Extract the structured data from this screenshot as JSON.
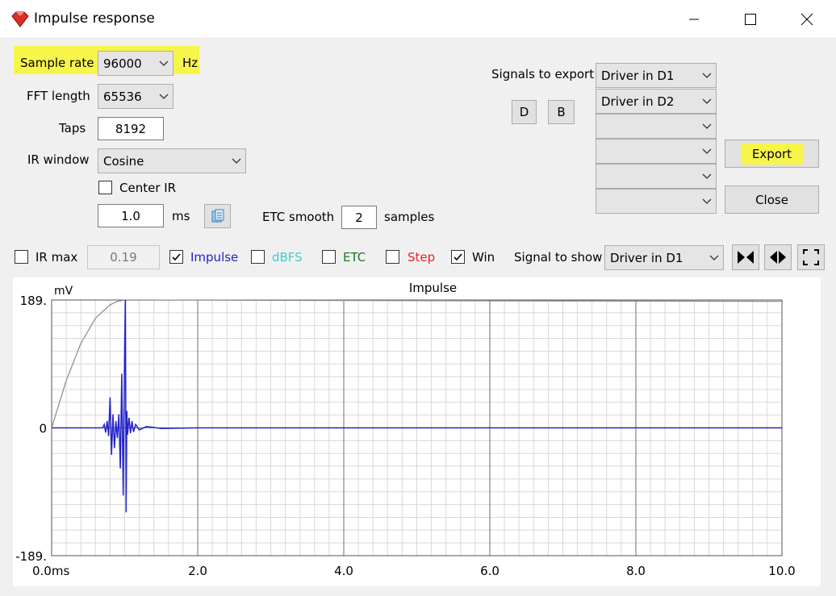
{
  "window": {
    "title": "Impulse response",
    "icon": "red-diamond-app-icon",
    "buttons": [
      "minimize-icon",
      "maximize-icon",
      "close-icon"
    ]
  },
  "settings": {
    "sample_rate_label": "Sample rate",
    "sample_rate_value": "96000",
    "sample_rate_unit": "Hz",
    "fft_label": "FFT length",
    "fft_value": "65536",
    "taps_label": "Taps",
    "taps_value": "8192",
    "ir_window_label": "IR window",
    "ir_window_value": "Cosine",
    "center_ir_label": "Center IR",
    "center_ir_checked": false,
    "ms_value": "1.0",
    "ms_unit": "ms",
    "etc_smooth_label": "ETC smooth",
    "etc_smooth_value": "2",
    "etc_smooth_unit": "samples"
  },
  "export": {
    "signals_label": "Signals to export",
    "d_button": "D",
    "b_button": "B",
    "signals": [
      "Driver in D1",
      "Driver in D2",
      "",
      "",
      "",
      ""
    ],
    "export_button": "Export",
    "close_button": "Close"
  },
  "toolbar": {
    "ir_max_label": "IR max",
    "ir_max_checked": false,
    "ir_max_value": "0.19",
    "impulse_label": "Impulse",
    "impulse_checked": true,
    "dbfs_label": "dBFS",
    "dbfs_checked": false,
    "etc_label": "ETC",
    "etc_checked": false,
    "step_label": "Step",
    "step_checked": false,
    "win_label": "Win",
    "win_checked": true,
    "signal_to_show_label": "Signal to show",
    "signal_to_show_value": "Driver in D1",
    "icons": [
      "collapse-icon",
      "expand-icon",
      "fullscreen-icon"
    ]
  },
  "colors": {
    "highlight": "#f8f54a",
    "impulse": "#2222cc",
    "dbfs": "#44cccc",
    "etc": "#227722",
    "step": "#ee2222",
    "window": "#888888"
  },
  "chart_data": {
    "type": "line",
    "title": "Impulse",
    "xlabel": "",
    "ylabel": "mV",
    "xlim": [
      0,
      10
    ],
    "ylim": [
      -189,
      189
    ],
    "x_ticks": [
      "0.0ms",
      "2.0",
      "4.0",
      "6.0",
      "8.0",
      "10.0"
    ],
    "y_ticks": [
      "189.",
      "0",
      "-189."
    ],
    "grid": true,
    "series": [
      {
        "color": "#2222cc",
        "x": [
          0,
          0.4,
          0.7,
          0.72,
          0.74,
          0.76,
          0.78,
          0.8,
          0.82,
          0.84,
          0.86,
          0.88,
          0.9,
          0.92,
          0.94,
          0.96,
          0.98,
          1.0,
          1.01,
          1.02,
          1.03,
          1.04,
          1.06,
          1.08,
          1.1,
          1.12,
          1.15,
          1.2,
          1.3,
          1.5,
          2.0,
          10
        ],
        "y": [
          0,
          0,
          0,
          5,
          -7,
          10,
          -12,
          45,
          -40,
          20,
          -30,
          10,
          -15,
          20,
          -60,
          80,
          -100,
          120,
          189,
          -125,
          25,
          -10,
          15,
          -8,
          10,
          -6,
          5,
          -3,
          2,
          -1,
          0,
          0
        ]
      },
      {
        "color": "#888888",
        "x": [
          0,
          0.2,
          0.4,
          0.6,
          0.8,
          0.9,
          1.0,
          10
        ],
        "y": [
          0,
          70,
          125,
          162,
          182,
          187,
          189,
          187
        ]
      }
    ]
  }
}
